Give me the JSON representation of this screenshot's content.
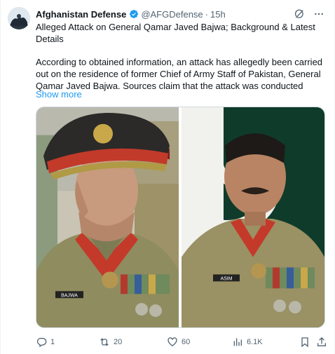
{
  "author": {
    "name": "Afghanistan Defense",
    "handle": "@AFGDefense",
    "separator": "·",
    "time": "15h",
    "avatar_icon": "avatar-silhouette",
    "verified_icon": "verified-badge-icon"
  },
  "tweet": {
    "title": "Alleged Attack on General Qamar Javed Bajwa; Background & Latest Details",
    "body": "According to obtained information, an attack has allegedly been carried out on the residence of former Chief of Army Staff of Pakistan, General Qamar Javed Bajwa. Sources claim that the attack was conducted",
    "show_more": "Show more"
  },
  "media": {
    "left_photo": {
      "name_tag": "BAJWA"
    },
    "right_photo": {
      "name_tag": "ASIM"
    }
  },
  "actions": {
    "replies": "1",
    "reposts": "20",
    "likes": "60",
    "views": "6.1K"
  },
  "colors": {
    "accent": "#1d9bf0",
    "text": "#0f1419",
    "muted": "#536471"
  }
}
